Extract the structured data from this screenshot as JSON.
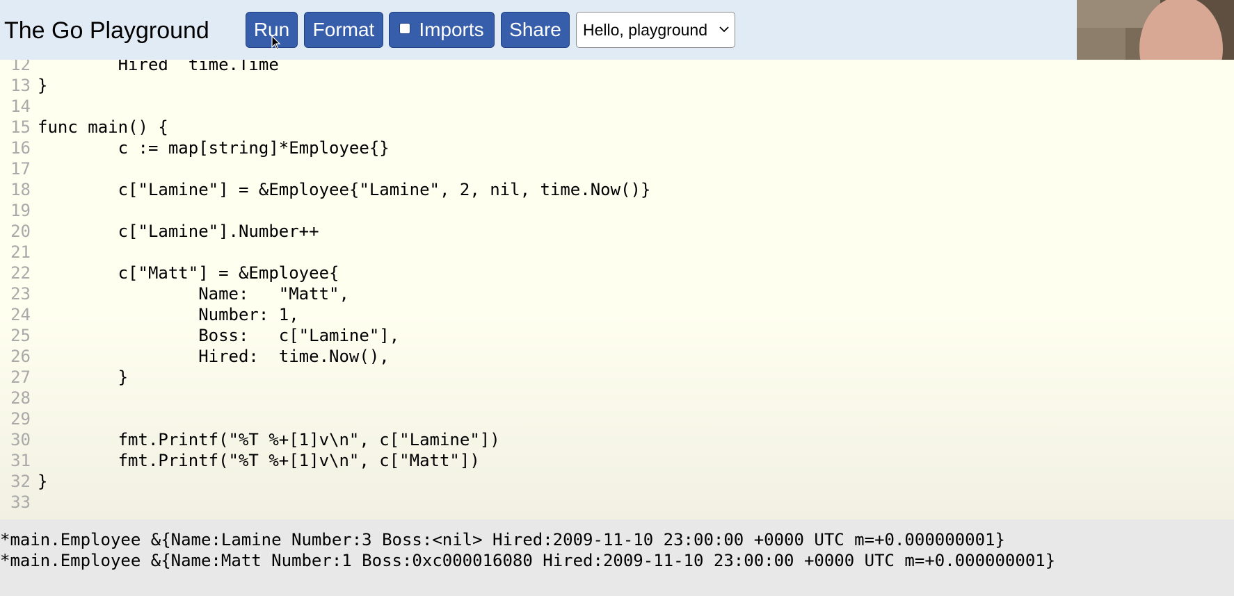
{
  "header": {
    "title": "The Go Playground",
    "run_label": "Run",
    "format_label": "Format",
    "imports_label": "Imports",
    "share_label": "Share",
    "examples_selected": "Hello, playground"
  },
  "colors": {
    "accent_button": "#375eab",
    "header_bg": "#e0ebf5",
    "editor_bg": "#fffff0",
    "output_bg": "#e8e8e8",
    "line_number": "#a9a9a9"
  },
  "icons": {
    "dropdown": "chevron-down-icon",
    "checkbox": "checkbox-icon",
    "cursor": "mouse-pointer-icon"
  },
  "imports_checked": false,
  "editor": {
    "lines": [
      {
        "n": "12",
        "text": "        Hired  time.Time"
      },
      {
        "n": "13",
        "text": "}"
      },
      {
        "n": "14",
        "text": ""
      },
      {
        "n": "15",
        "text": "func main() {"
      },
      {
        "n": "16",
        "text": "        c := map[string]*Employee{}"
      },
      {
        "n": "17",
        "text": ""
      },
      {
        "n": "18",
        "text": "        c[\"Lamine\"] = &Employee{\"Lamine\", 2, nil, time.Now()}"
      },
      {
        "n": "19",
        "text": ""
      },
      {
        "n": "20",
        "text": "        c[\"Lamine\"].Number++"
      },
      {
        "n": "21",
        "text": ""
      },
      {
        "n": "22",
        "text": "        c[\"Matt\"] = &Employee{"
      },
      {
        "n": "23",
        "text": "                Name:   \"Matt\","
      },
      {
        "n": "24",
        "text": "                Number: 1,"
      },
      {
        "n": "25",
        "text": "                Boss:   c[\"Lamine\"],"
      },
      {
        "n": "26",
        "text": "                Hired:  time.Now(),"
      },
      {
        "n": "27",
        "text": "        }"
      },
      {
        "n": "28",
        "text": ""
      },
      {
        "n": "29",
        "text": ""
      },
      {
        "n": "30",
        "text": "        fmt.Printf(\"%T %+[1]v\\n\", c[\"Lamine\"])"
      },
      {
        "n": "31",
        "text": "        fmt.Printf(\"%T %+[1]v\\n\", c[\"Matt\"])"
      },
      {
        "n": "32",
        "text": "}"
      },
      {
        "n": "33",
        "text": ""
      }
    ]
  },
  "output": {
    "lines": [
      "*main.Employee &{Name:Lamine Number:3 Boss:<nil> Hired:2009-11-10 23:00:00 +0000 UTC m=+0.000000001}",
      "*main.Employee &{Name:Matt Number:1 Boss:0xc000016080 Hired:2009-11-10 23:00:00 +0000 UTC m=+0.000000001}"
    ]
  }
}
